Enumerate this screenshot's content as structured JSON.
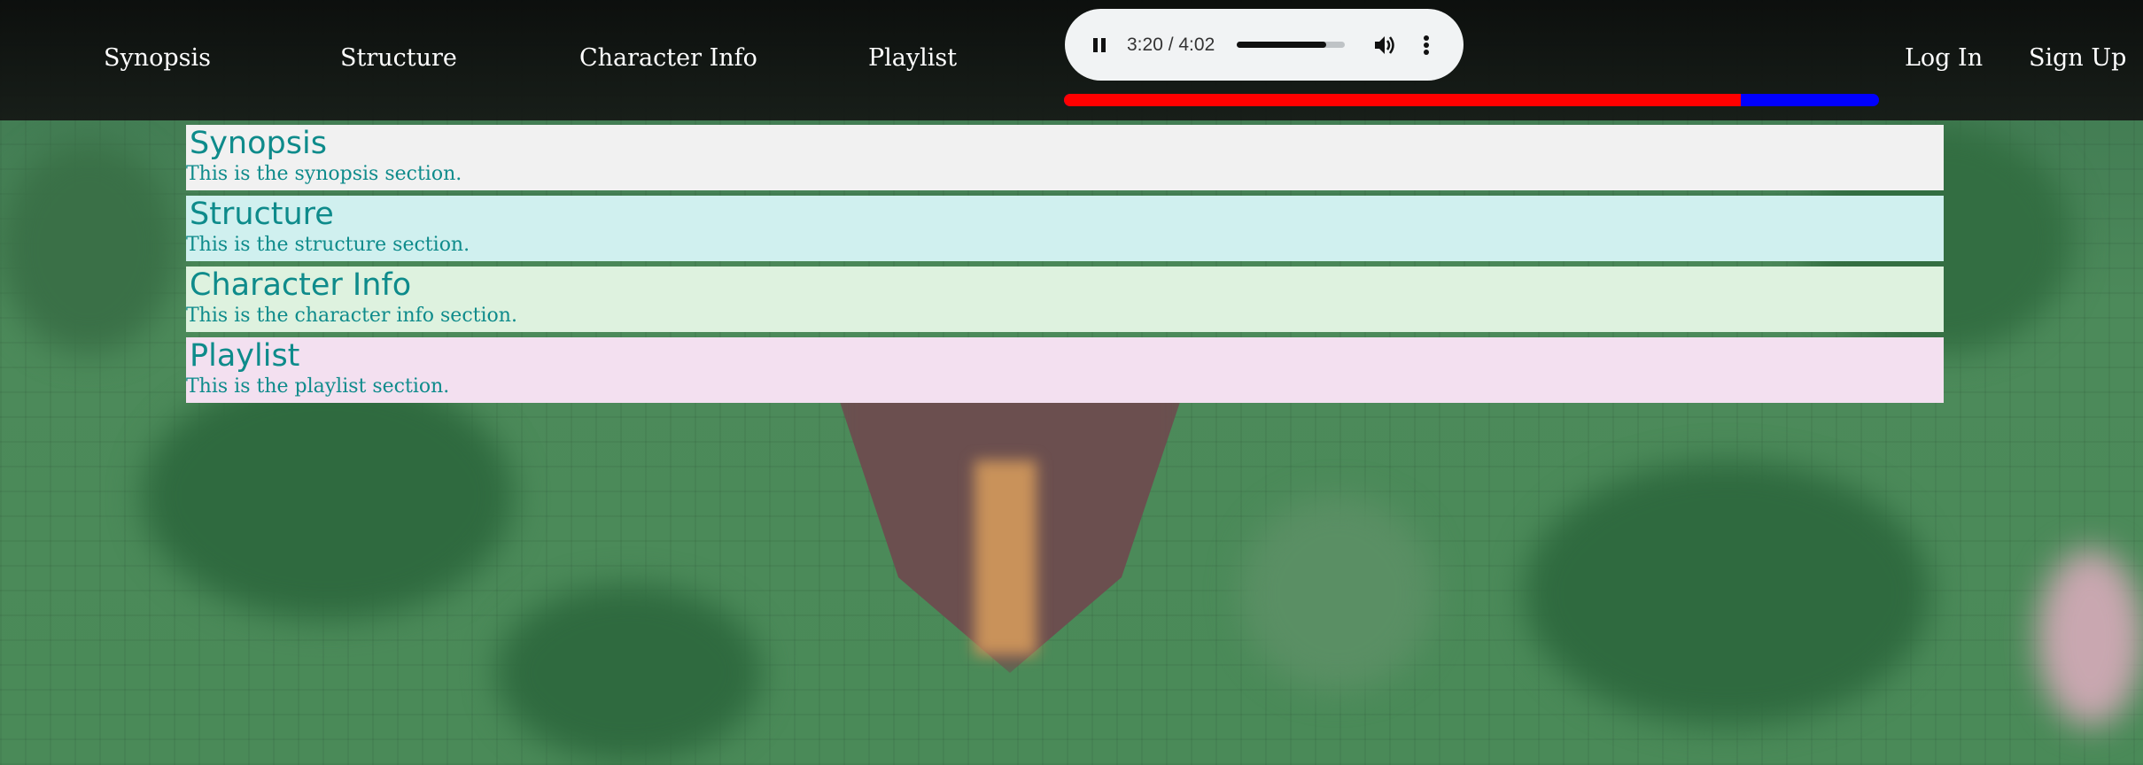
{
  "nav": {
    "items": [
      {
        "label": "Synopsis"
      },
      {
        "label": "Structure"
      },
      {
        "label": "Character Info"
      },
      {
        "label": "Playlist"
      }
    ],
    "login_label": "Log In",
    "signup_label": "Sign Up"
  },
  "player": {
    "time": "3:20 / 4:02",
    "progress_fraction": 0.826,
    "play_icon": "pause-icon",
    "volume_icon": "volume-icon",
    "more_icon": "more-vertical-icon"
  },
  "external_progress": {
    "fraction": 0.83,
    "played_color": "#ff0000",
    "remaining_color": "#0000ff"
  },
  "sections": [
    {
      "title": "Synopsis",
      "text": "This is the synopsis section.",
      "bg": "#f1f1f1"
    },
    {
      "title": "Structure",
      "text": "This is the structure section.",
      "bg": "#d0f0ef"
    },
    {
      "title": "Character Info",
      "text": "This is the character info section.",
      "bg": "#def2df"
    },
    {
      "title": "Playlist",
      "text": "This is the playlist section.",
      "bg": "#f3e0f0"
    }
  ],
  "colors": {
    "section_text": "#0e8b8b",
    "nav_text": "#ffffff",
    "topbar": "#101010"
  }
}
